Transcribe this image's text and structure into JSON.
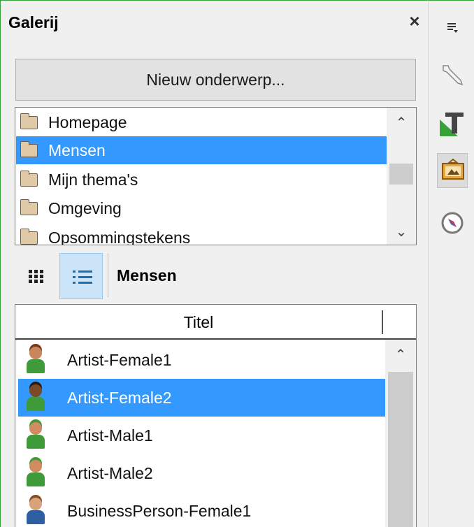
{
  "panel": {
    "title": "Galerij",
    "close_glyph": "×",
    "new_topic_label": "Nieuw onderwerp..."
  },
  "topics": [
    {
      "label": "Homepage",
      "selected": false
    },
    {
      "label": "Mensen",
      "selected": true
    },
    {
      "label": "Mijn thema's",
      "selected": false
    },
    {
      "label": "Omgeving",
      "selected": false
    },
    {
      "label": "Opsommingstekens",
      "selected": false
    }
  ],
  "view": {
    "current_topic": "Mensen",
    "mode": "list"
  },
  "item_list": {
    "column_header": "Titel",
    "rows": [
      {
        "label": "Artist-Female1",
        "selected": false,
        "head_color": "#c9855c",
        "body_color": "#3f9a3a",
        "hair_color": "#7a3a1a"
      },
      {
        "label": "Artist-Female2",
        "selected": true,
        "head_color": "#7a4a2a",
        "body_color": "#3f9a3a",
        "hair_color": "#2a1a10"
      },
      {
        "label": "Artist-Male1",
        "selected": false,
        "head_color": "#d08c60",
        "body_color": "#3f9a3a",
        "hair_color": "#3f9a3a"
      },
      {
        "label": "Artist-Male2",
        "selected": false,
        "head_color": "#d08c60",
        "body_color": "#3f9a3a",
        "hair_color": "#3f9a3a"
      },
      {
        "label": "BusinessPerson-Female1",
        "selected": false,
        "head_color": "#d8a37a",
        "body_color": "#2f5fa0",
        "hair_color": "#8a4a22"
      }
    ]
  },
  "sidebar_tabs": [
    {
      "icon": "sidebar-menu-icon",
      "active": false
    },
    {
      "icon": "properties-wrench-icon",
      "active": false
    },
    {
      "icon": "styles-icon",
      "active": false
    },
    {
      "icon": "gallery-icon",
      "active": true
    },
    {
      "icon": "navigator-icon",
      "active": false
    }
  ],
  "colors": {
    "selection": "#3399ff",
    "accent_border": "#3aa23a"
  }
}
